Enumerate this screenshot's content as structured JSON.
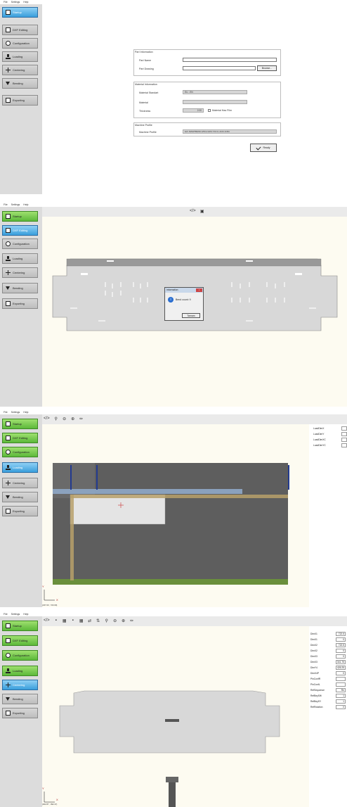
{
  "menu": [
    "File",
    "Settings",
    "Help"
  ],
  "sidebar": [
    "Startup",
    "DXF Editing",
    "Configuration",
    "Loading",
    "Centering",
    "Bending",
    "Exporting"
  ],
  "startup_form": {
    "part_info_title": "Part Information",
    "part_name_label": "Part Name",
    "part_drawing_label": "Part Drawing",
    "browse_label": "Browse...",
    "material_info_title": "Material Information",
    "material_standard_label": "Material Standart",
    "material_standard_value": "EU - EN",
    "material_label": "Material",
    "thickness_label": "Thickness",
    "thickness_value": "2.00",
    "material_has_film_label": "Material Has Film",
    "machine_profile_title": "Machine Profile",
    "machine_profile_label": "Machine Profile",
    "machine_profile_value": "ELF-SMARTBEND-1250-H120S-Y60-CL-2100-10-BA",
    "ready_label": "Ready"
  },
  "dialog": {
    "title": "Information",
    "message": "Bend count: 9",
    "ok_label": "Tamam"
  },
  "loading": {
    "params": [
      "LoadDimX",
      "LoadDimY",
      "LoadDimXC",
      "LoadDimYC"
    ],
    "axis_y": "Y",
    "axis_x": "X",
    "coord": "(237.00 ; 723.09)"
  },
  "centering": {
    "params": [
      {
        "label": "DimX1",
        "value": "722.5"
      },
      {
        "label": "DimX1",
        "value": "0"
      },
      {
        "label": "DimX2",
        "value": "722.5"
      },
      {
        "label": "DimX2",
        "value": "0"
      },
      {
        "label": "DimX3",
        "value": "0"
      },
      {
        "label": "DimX3",
        "value": "341.75"
      },
      {
        "label": "DimY4",
        "value": "426.25"
      },
      {
        "label": "DimX4P",
        "value": "0"
      },
      {
        "label": "PinConfR",
        "value": ""
      },
      {
        "label": "PinConfL",
        "value": ""
      },
      {
        "label": "RefSequence",
        "value": "Re"
      },
      {
        "label": "RefBeySift",
        "value": "1"
      },
      {
        "label": "RefBeySY",
        "value": "1"
      },
      {
        "label": "RefRotation",
        "value": "V"
      }
    ],
    "axis_y": "Y",
    "axis_x": "X",
    "coord": "(302.87 ; 392.47)"
  },
  "colors": {
    "green": "#5cb83a",
    "blue": "#3a9fdc",
    "canvas": "#fdfbf1",
    "plate": "#dcdcdc",
    "machine": "#5e5e5e"
  }
}
